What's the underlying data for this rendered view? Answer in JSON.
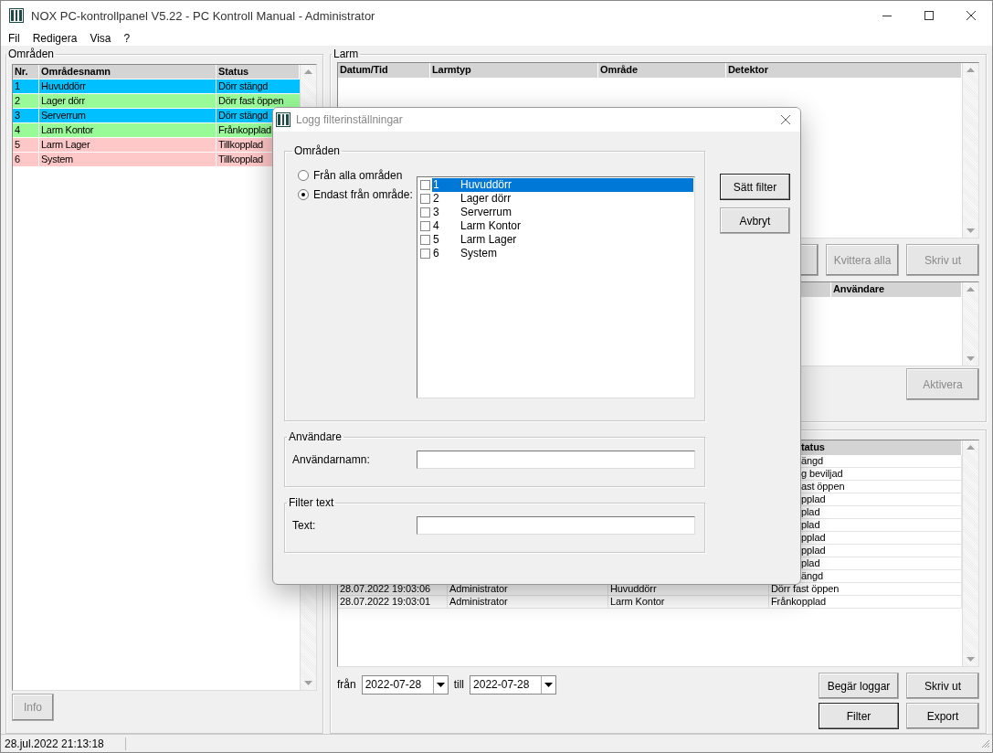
{
  "window": {
    "title": "NOX PC-kontrollpanel V5.22 - PC Kontroll Manual - Administrator"
  },
  "menu": [
    "Fil",
    "Redigera",
    "Visa",
    "?"
  ],
  "areas_panel": {
    "title": "Områden",
    "columns": [
      "Nr.",
      "Områdesnamn",
      "Status"
    ],
    "rows": [
      {
        "nr": "1",
        "name": "Huvuddörr",
        "status": "Dörr stängd",
        "color": "#00c0ff"
      },
      {
        "nr": "2",
        "name": "Lager dörr",
        "status": "Dörr fast öppen",
        "color": "#98fb98"
      },
      {
        "nr": "3",
        "name": "Serverrum",
        "status": "Dörr stängd",
        "color": "#00c0ff"
      },
      {
        "nr": "4",
        "name": "Larm Kontor",
        "status": "Frånkopplad",
        "color": "#98fb98"
      },
      {
        "nr": "5",
        "name": "Larm Lager",
        "status": "Tillkopplad",
        "color": "#ffc8c8"
      },
      {
        "nr": "6",
        "name": "System",
        "status": "Tillkopplad",
        "color": "#ffc8c8"
      }
    ],
    "info_button": {
      "label": "Info",
      "disabled": true
    }
  },
  "alarm_panel": {
    "title": "Larm",
    "columns": [
      "Datum/Tid",
      "Larmtyp",
      "Område",
      "Detektor"
    ],
    "buttons": [
      {
        "label": "Kvittera alla",
        "disabled": true
      },
      {
        "label": "Skriv ut",
        "disabled": true
      }
    ],
    "users_columns": [
      "Användare"
    ],
    "activate_button": {
      "label": "Aktivera",
      "disabled": true
    }
  },
  "log_panel": {
    "columns": [
      "tatus"
    ],
    "rows": [
      {
        "status": "ängd"
      },
      {
        "status": "g beviljad"
      },
      {
        "status": "ast öppen"
      },
      {
        "status": "pplad"
      },
      {
        "status": "plad"
      },
      {
        "status": "plad"
      },
      {
        "status": "pplad"
      },
      {
        "status": "pplad"
      },
      {
        "status": "plad"
      },
      {
        "status": "ängd"
      },
      {
        "date": "28.07.2022 19:03:06",
        "user": "Administrator",
        "area": "Huvuddörr",
        "status": "Dörr fast öppen"
      },
      {
        "date": "28.07.2022 19:03:01",
        "user": "Administrator",
        "area": "Larm Kontor",
        "status": "Frånkopplad"
      }
    ],
    "from_label": "från",
    "from_date": "2022-07-28",
    "to_label": "till",
    "to_date": "2022-07-28",
    "buttons": [
      {
        "label": "Begär loggar",
        "default": false
      },
      {
        "label": "Skriv ut",
        "default": false
      },
      {
        "label": "Filter",
        "default": true
      },
      {
        "label": "Export",
        "default": false
      }
    ]
  },
  "status_bar": {
    "datetime": "28.jul.2022  21:13:18"
  },
  "dialog": {
    "title": "Logg filterinställningar",
    "areas_group": {
      "title": "Områden",
      "radios": [
        {
          "label": "Från alla områden",
          "selected": false
        },
        {
          "label": "Endast från område:",
          "selected": true
        }
      ],
      "items": [
        {
          "nr": "1",
          "name": "Huvuddörr",
          "checked": false,
          "selected": true
        },
        {
          "nr": "2",
          "name": "Lager dörr",
          "checked": false,
          "selected": false
        },
        {
          "nr": "3",
          "name": "Serverrum",
          "checked": false,
          "selected": false
        },
        {
          "nr": "4",
          "name": "Larm Kontor",
          "checked": false,
          "selected": false
        },
        {
          "nr": "5",
          "name": "Larm Lager",
          "checked": false,
          "selected": false
        },
        {
          "nr": "6",
          "name": "System",
          "checked": false,
          "selected": false
        }
      ]
    },
    "user_group": {
      "title": "Användare",
      "label": "Användarnamn:"
    },
    "text_group": {
      "title": "Filter text",
      "label": "Text:"
    },
    "buttons": [
      {
        "label": "Sätt filter",
        "default": true
      },
      {
        "label": "Avbryt",
        "default": false
      }
    ]
  }
}
